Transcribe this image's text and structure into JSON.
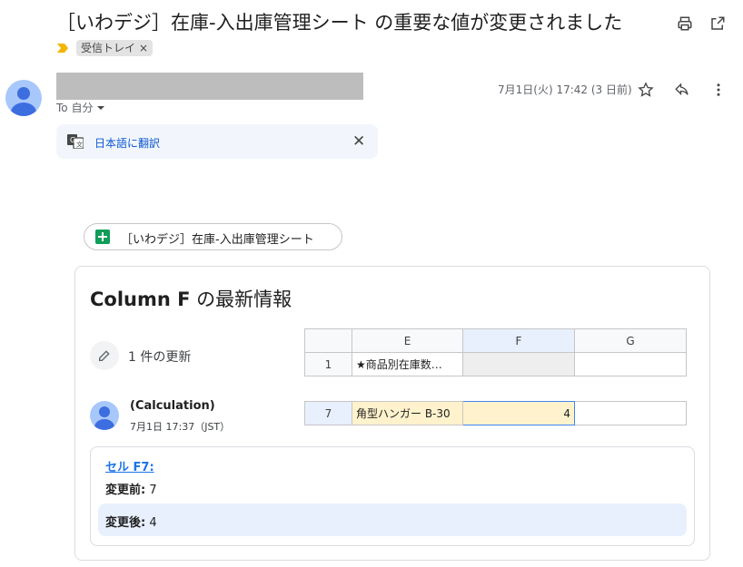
{
  "subject": "［いわデジ］在庫-入出庫管理シート の重要な値が変更されました",
  "label": {
    "name": "受信トレイ",
    "remove": "×"
  },
  "sender": {
    "to_text": "To 自分",
    "date": "7月1日(火) 17:42 (3 日前)"
  },
  "translate": {
    "label": "日本語に翻訳",
    "close": "✕"
  },
  "sheet_chip": {
    "label": "［いわデジ］在庫-入出庫管理シート"
  },
  "card": {
    "title_bold": "Column F",
    "title_rest": " の最新情報",
    "updates": "1 件の更新",
    "header_grid": {
      "cols": [
        "",
        "E",
        "F",
        "G"
      ],
      "row_num": "1",
      "row_e": "★商品別在庫数…",
      "row_f": "",
      "row_g": ""
    },
    "change_grid": {
      "row_num": "7",
      "e": "角型ハンガー B-30",
      "f": "4",
      "g": ""
    },
    "author": {
      "name": "(Calculation)",
      "time": "7月1日 17:37（JST）"
    },
    "detail": {
      "cell_link": "セル F7:",
      "before_label": "変更前:",
      "before_value": " 7",
      "after_label": "変更後:",
      "after_value": " 4"
    }
  },
  "colors": {
    "accent": "#0b57d0",
    "sheets_green": "#0f9d58",
    "important_marker": "#f4b400"
  },
  "icons": [
    "print-icon",
    "open-in-new-icon",
    "important-marker-icon",
    "star-icon",
    "reply-icon",
    "more-vert-icon",
    "translate-icon",
    "pencil-icon",
    "sheets-icon",
    "chevron-down-icon"
  ]
}
